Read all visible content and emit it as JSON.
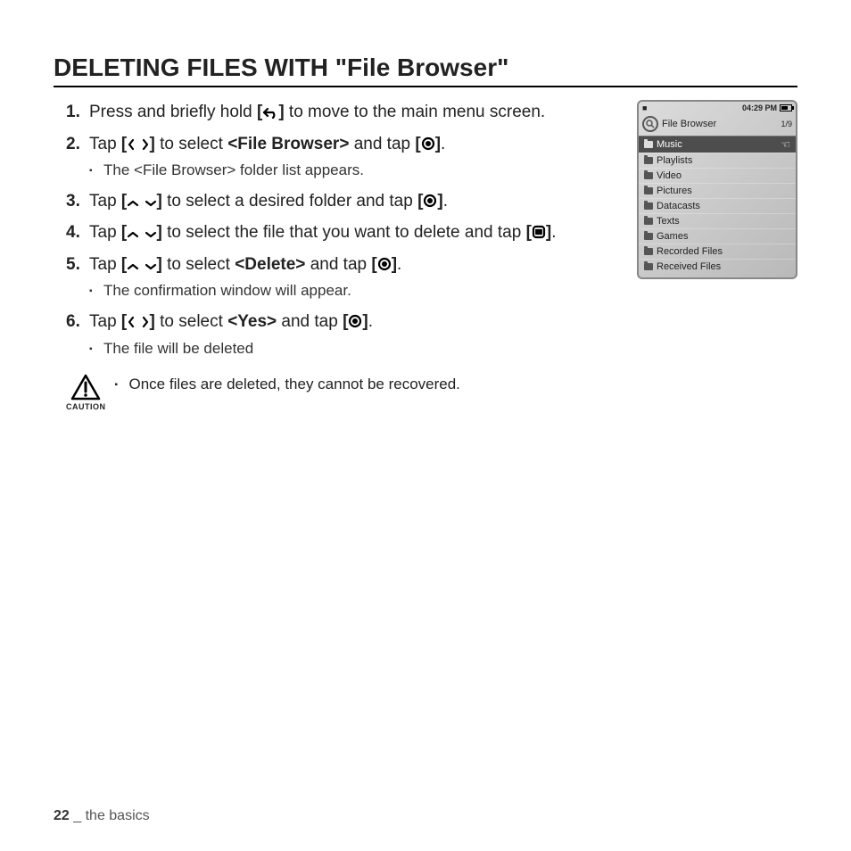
{
  "title": "DELETING FILES WITH \"File Browser\"",
  "steps": [
    {
      "num": "1.",
      "parts": [
        "Press and briefly hold ",
        {
          "b": "["
        },
        {
          "icon": "back"
        },
        {
          "b": "]"
        },
        " to move to the main menu screen."
      ]
    },
    {
      "num": "2.",
      "parts": [
        "Tap ",
        {
          "b": "["
        },
        {
          "icon": "left"
        },
        " ",
        {
          "icon": "right"
        },
        {
          "b": "]"
        },
        " to select ",
        {
          "b": "<File Browser>"
        },
        " and tap ",
        {
          "b": "["
        },
        {
          "icon": "target"
        },
        {
          "b": "]"
        },
        "."
      ],
      "sub": [
        "The <File Browser> folder list appears."
      ]
    },
    {
      "num": "3.",
      "parts": [
        "Tap ",
        {
          "b": "["
        },
        {
          "icon": "up"
        },
        " ",
        {
          "icon": "down"
        },
        {
          "b": "]"
        },
        " to select a desired folder and tap ",
        {
          "b": "["
        },
        {
          "icon": "target"
        },
        {
          "b": "]"
        },
        "."
      ]
    },
    {
      "num": "4.",
      "parts": [
        "Tap ",
        {
          "b": "["
        },
        {
          "icon": "up"
        },
        " ",
        {
          "icon": "down"
        },
        {
          "b": "]"
        },
        " to select the file that you want to delete and tap ",
        {
          "b": "["
        },
        {
          "icon": "menu"
        },
        {
          "b": "]"
        },
        "."
      ]
    },
    {
      "num": "5.",
      "parts": [
        "Tap ",
        {
          "b": "["
        },
        {
          "icon": "up"
        },
        " ",
        {
          "icon": "down"
        },
        {
          "b": "]"
        },
        " to select ",
        {
          "b": "<Delete>"
        },
        " and tap ",
        {
          "b": "["
        },
        {
          "icon": "target"
        },
        {
          "b": "]"
        },
        "."
      ],
      "sub": [
        "The confirmation window will appear."
      ]
    },
    {
      "num": "6.",
      "parts": [
        " Tap ",
        {
          "b": "["
        },
        {
          "icon": "left"
        },
        " ",
        {
          "icon": "right"
        },
        {
          "b": "]"
        },
        " to select ",
        {
          "b": "<Yes>"
        },
        " and tap ",
        {
          "b": "["
        },
        {
          "icon": "target"
        },
        {
          "b": "]"
        },
        "."
      ],
      "sub": [
        "The file will be deleted"
      ]
    }
  ],
  "caution": {
    "label": "CAUTION",
    "text": "Once files are deleted, they cannot be recovered."
  },
  "device": {
    "time": "04:29 PM",
    "title": "File Browser",
    "index": "1/9",
    "items": [
      {
        "label": "Music",
        "selected": true
      },
      {
        "label": "Playlists"
      },
      {
        "label": "Video"
      },
      {
        "label": "Pictures"
      },
      {
        "label": "Datacasts"
      },
      {
        "label": "Texts"
      },
      {
        "label": "Games"
      },
      {
        "label": "Recorded Files"
      },
      {
        "label": "Received Files"
      }
    ]
  },
  "footer": {
    "page": "22",
    "sep": " _ ",
    "section": "the basics"
  }
}
